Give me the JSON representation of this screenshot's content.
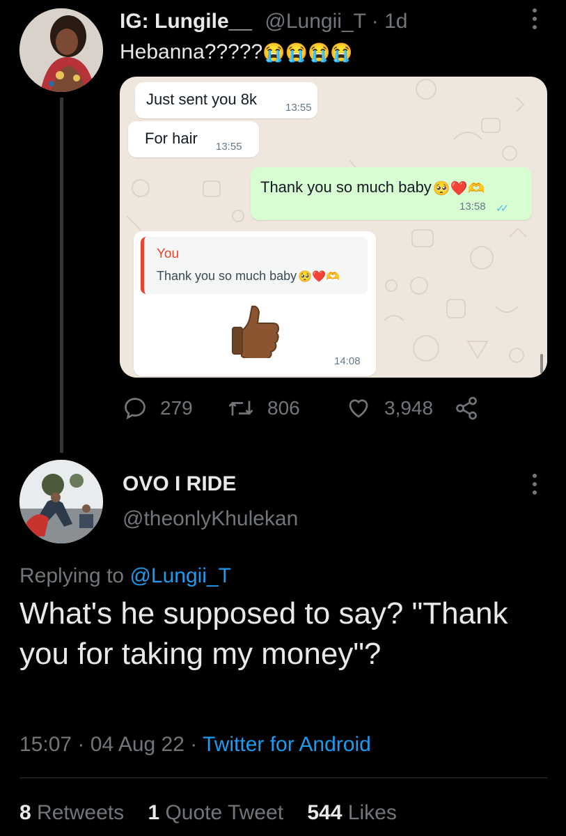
{
  "parent_tweet": {
    "display_name": "IG: Lungile__",
    "handle": "@Lungii_T",
    "separator": "·",
    "age": "1d",
    "text": "Hebanna?????",
    "text_emojis": "😭😭😭😭",
    "avatar_icon": "profile-photo",
    "more_icon": "more-options-icon"
  },
  "chat": {
    "messages": [
      {
        "direction": "incoming",
        "text": "Just sent you 8k",
        "time": "13:55"
      },
      {
        "direction": "incoming",
        "text": "For hair",
        "time": "13:55"
      },
      {
        "direction": "outgoing",
        "text": "Thank you so much baby",
        "emojis": "🥺❤️🫶",
        "time": "13:58",
        "status": "read-ticks-icon"
      },
      {
        "direction": "incoming",
        "quote_author": "You",
        "quote_text": "Thank you so much baby",
        "quote_emojis": "🥺❤️🫶",
        "sticker": "thumbs-up-icon",
        "time": "14:08"
      }
    ],
    "colors": {
      "background": "#efe7dd",
      "outgoing": "#d9fdd3",
      "incoming": "#ffffff",
      "quote_accent": "#e8452e",
      "read_ticks": "#53bdeb"
    }
  },
  "actions": {
    "replies": "279",
    "retweets": "806",
    "likes": "3,948",
    "icons": [
      "reply-icon",
      "retweet-icon",
      "like-icon",
      "share-icon"
    ]
  },
  "reply_tweet": {
    "display_name": "OVO I RIDE",
    "handle": "@theonlyKhulekan",
    "replying_prefix": "Replying to",
    "replying_to": "@Lungii_T",
    "text": "What's he supposed to say? \"Thank you for taking my money\"?",
    "time": "15:07",
    "sep1": "·",
    "date": "04 Aug 22",
    "sep2": "·",
    "source": "Twitter for Android"
  },
  "stats": {
    "retweets_count": "8",
    "retweets_label": "Retweets",
    "quotes_count": "1",
    "quotes_label": "Quote Tweet",
    "likes_count": "544",
    "likes_label": "Likes"
  },
  "colors": {
    "background": "#000000",
    "text": "#e7e9ea",
    "muted": "#71767b",
    "link": "#1d9bf0"
  }
}
